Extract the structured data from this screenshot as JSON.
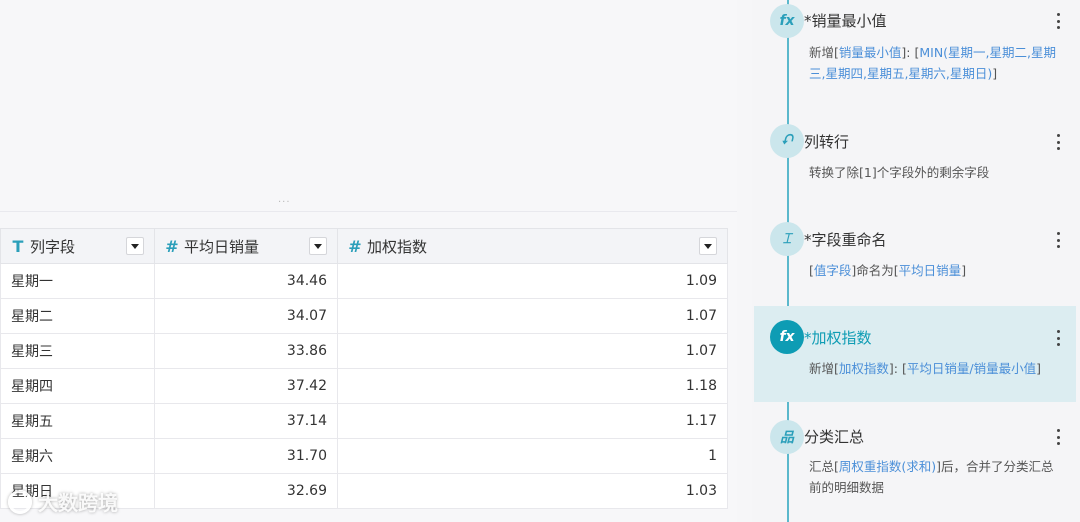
{
  "table": {
    "columns": [
      {
        "icon": "T",
        "label": "列字段",
        "type": "text"
      },
      {
        "icon": "#",
        "label": "平均日销量",
        "type": "number"
      },
      {
        "icon": "#",
        "label": "加权指数",
        "type": "number"
      }
    ],
    "rows": [
      [
        "星期一",
        "34.46",
        "1.09"
      ],
      [
        "星期二",
        "34.07",
        "1.07"
      ],
      [
        "星期三",
        "33.86",
        "1.07"
      ],
      [
        "星期四",
        "37.42",
        "1.18"
      ],
      [
        "星期五",
        "37.14",
        "1.17"
      ],
      [
        "星期六",
        "31.70",
        "1"
      ],
      [
        "星期日",
        "32.69",
        "1.03"
      ]
    ]
  },
  "steps": [
    {
      "icon": "fx",
      "icon_name": "formula-icon",
      "title": "*销量最小值",
      "desc": [
        [
          "新增[",
          ""
        ],
        [
          "销量最小值",
          "hl"
        ],
        [
          "]: [",
          ""
        ],
        [
          "MIN(星期一,星期二,星期三,星期四,星期五,星期六,星期日)",
          "hl"
        ],
        [
          "]",
          ""
        ]
      ]
    },
    {
      "icon": "⮏",
      "icon_name": "column-to-row-icon",
      "title": "列转行",
      "desc": [
        [
          "转换了除[1]个字段外的剩余字段",
          ""
        ]
      ]
    },
    {
      "icon": "⌶",
      "icon_name": "rename-field-icon",
      "title": "*字段重命名",
      "desc": [
        [
          "[",
          ""
        ],
        [
          "值字段",
          "hl"
        ],
        [
          "]命名为[",
          ""
        ],
        [
          "平均日销量",
          "hl"
        ],
        [
          "]",
          ""
        ]
      ]
    },
    {
      "icon": "fx",
      "icon_name": "formula-icon",
      "title": "*加权指数",
      "active": true,
      "desc": [
        [
          "新增[",
          ""
        ],
        [
          "加权指数",
          "hl"
        ],
        [
          "]: [",
          ""
        ],
        [
          "平均日销量/销量最小值",
          "hl"
        ],
        [
          "]",
          ""
        ]
      ]
    },
    {
      "icon": "品",
      "icon_name": "group-summary-icon",
      "title": "分类汇总",
      "desc": [
        [
          "汇总[",
          ""
        ],
        [
          "周权重指数(求和)",
          "hl"
        ],
        [
          "]后，合并了分类汇总前的明细数据",
          ""
        ]
      ]
    }
  ],
  "split_handle": "...",
  "watermark": "大数跨境"
}
